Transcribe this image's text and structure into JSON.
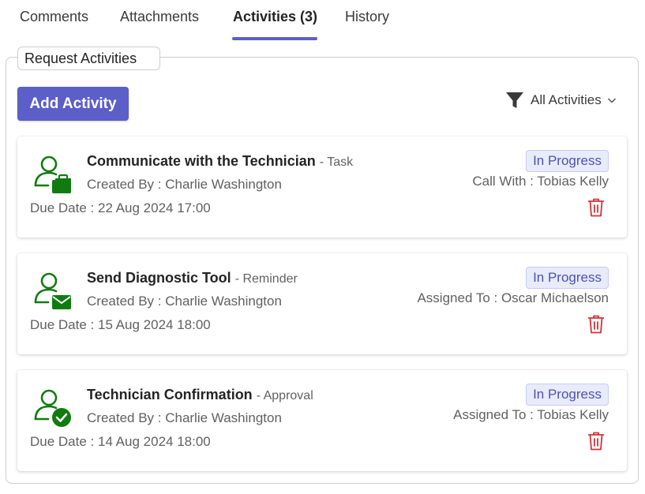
{
  "tabs": [
    {
      "label": "Comments",
      "active": false
    },
    {
      "label": "Attachments",
      "active": false
    },
    {
      "label": "Activities (3)",
      "active": true
    },
    {
      "label": "History",
      "active": false
    }
  ],
  "section": {
    "title": "Request Activities",
    "add_button": "Add Activity",
    "filter": {
      "icon": "filter-icon",
      "label": "All Activities",
      "chevron": "chevron-down-icon"
    }
  },
  "colors": {
    "accent": "#5b5fc7",
    "icon_green": "#107c10",
    "delete_red": "#d13438",
    "badge_bg": "#e8ebfa",
    "badge_text": "#4f52b2"
  },
  "activities": [
    {
      "title": "Communicate with the Technician",
      "type": "- Task",
      "created_by": "Created By : Charlie Washington",
      "due_date": "Due Date : 22 Aug 2024 17:00",
      "status": "In Progress",
      "assignee": "Call With : Tobias Kelly",
      "icon": "user-briefcase-icon"
    },
    {
      "title": "Send Diagnostic Tool",
      "type": "- Reminder",
      "created_by": "Created By : Charlie Washington",
      "due_date": "Due Date : 15 Aug 2024 18:00",
      "status": "In Progress",
      "assignee": "Assigned To : Oscar Michaelson",
      "icon": "user-mail-icon"
    },
    {
      "title": "Technician Confirmation",
      "type": "- Approval",
      "created_by": "Created By : Charlie Washington",
      "due_date": "Due Date : 14 Aug 2024 18:00",
      "status": "In Progress",
      "assignee": "Assigned To : Tobias Kelly",
      "icon": "user-check-icon"
    }
  ]
}
